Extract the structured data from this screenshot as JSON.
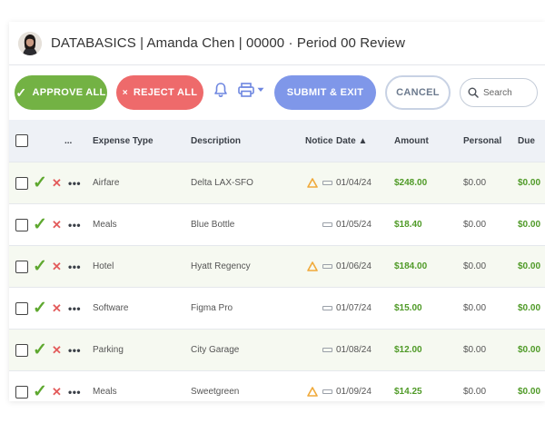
{
  "header": {
    "title": "DATABASICS | Amanda Chen | 00000 · Period 00 Review"
  },
  "toolbar": {
    "approve_all": "APPROVE ALL",
    "reject_all": "REJECT ALL",
    "submit_exit": "SUBMIT & EXIT",
    "cancel": "CANCEL",
    "search_placeholder": "Search",
    "approve_glyph": "✓",
    "reject_glyph": "×"
  },
  "colors": {
    "approve": "#73b244",
    "reject": "#ee6a6b",
    "submit": "#7f97e9",
    "accent_icon": "#6d86e0",
    "money": "#4f9a27",
    "warning": "#f0a93a"
  },
  "table": {
    "headers": {
      "more": "...",
      "type": "Expense Type",
      "description": "Description",
      "notice": "Notice",
      "date": "Date ▲",
      "amount": "Amount",
      "personal": "Personal",
      "due": "Due"
    },
    "row_glyphs": {
      "approve": "✓",
      "reject": "✕",
      "more": "•••"
    },
    "rows": [
      {
        "type": "Airfare",
        "description": "Delta LAX-SFO",
        "warning": true,
        "date": "01/04/24",
        "amount": "$248.00",
        "personal": "$0.00",
        "due": "$0.00"
      },
      {
        "type": "Meals",
        "description": "Blue Bottle",
        "warning": false,
        "date": "01/05/24",
        "amount": "$18.40",
        "personal": "$0.00",
        "due": "$0.00"
      },
      {
        "type": "Hotel",
        "description": "Hyatt Regency",
        "warning": true,
        "date": "01/06/24",
        "amount": "$184.00",
        "personal": "$0.00",
        "due": "$0.00"
      },
      {
        "type": "Software",
        "description": "Figma Pro",
        "warning": false,
        "date": "01/07/24",
        "amount": "$15.00",
        "personal": "$0.00",
        "due": "$0.00"
      },
      {
        "type": "Parking",
        "description": "City Garage",
        "warning": false,
        "date": "01/08/24",
        "amount": "$12.00",
        "personal": "$0.00",
        "due": "$0.00"
      },
      {
        "type": "Meals",
        "description": "Sweetgreen",
        "warning": true,
        "date": "01/09/24",
        "amount": "$14.25",
        "personal": "$0.00",
        "due": "$0.00"
      }
    ]
  }
}
